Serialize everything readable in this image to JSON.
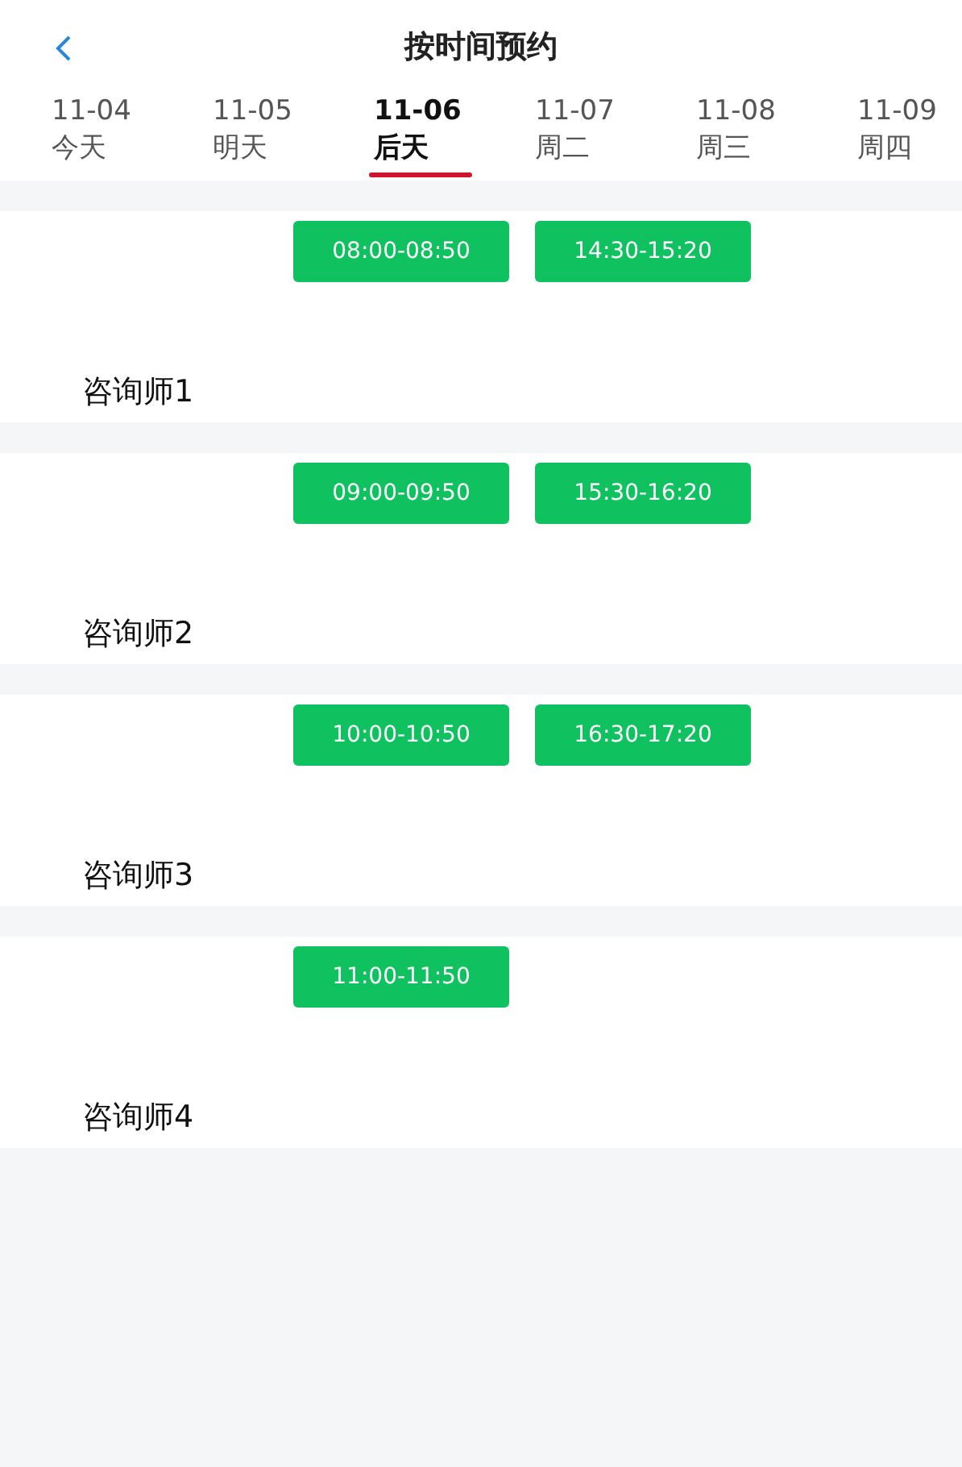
{
  "header": {
    "title": "按时间预约"
  },
  "dates": [
    {
      "date": "11-04",
      "label": "今天",
      "selected": false
    },
    {
      "date": "11-05",
      "label": "明天",
      "selected": false
    },
    {
      "date": "11-06",
      "label": "后天",
      "selected": true
    },
    {
      "date": "11-07",
      "label": "周二",
      "selected": false
    },
    {
      "date": "11-08",
      "label": "周三",
      "selected": false
    },
    {
      "date": "11-09",
      "label": "周四",
      "selected": false
    }
  ],
  "counselors": [
    {
      "name": "咨询师1",
      "slots": [
        "08:00-08:50",
        "14:30-15:20"
      ]
    },
    {
      "name": "咨询师2",
      "slots": [
        "09:00-09:50",
        "15:30-16:20"
      ]
    },
    {
      "name": "咨询师3",
      "slots": [
        "10:00-10:50",
        "16:30-17:20"
      ]
    },
    {
      "name": "咨询师4",
      "slots": [
        "11:00-11:50"
      ]
    }
  ]
}
